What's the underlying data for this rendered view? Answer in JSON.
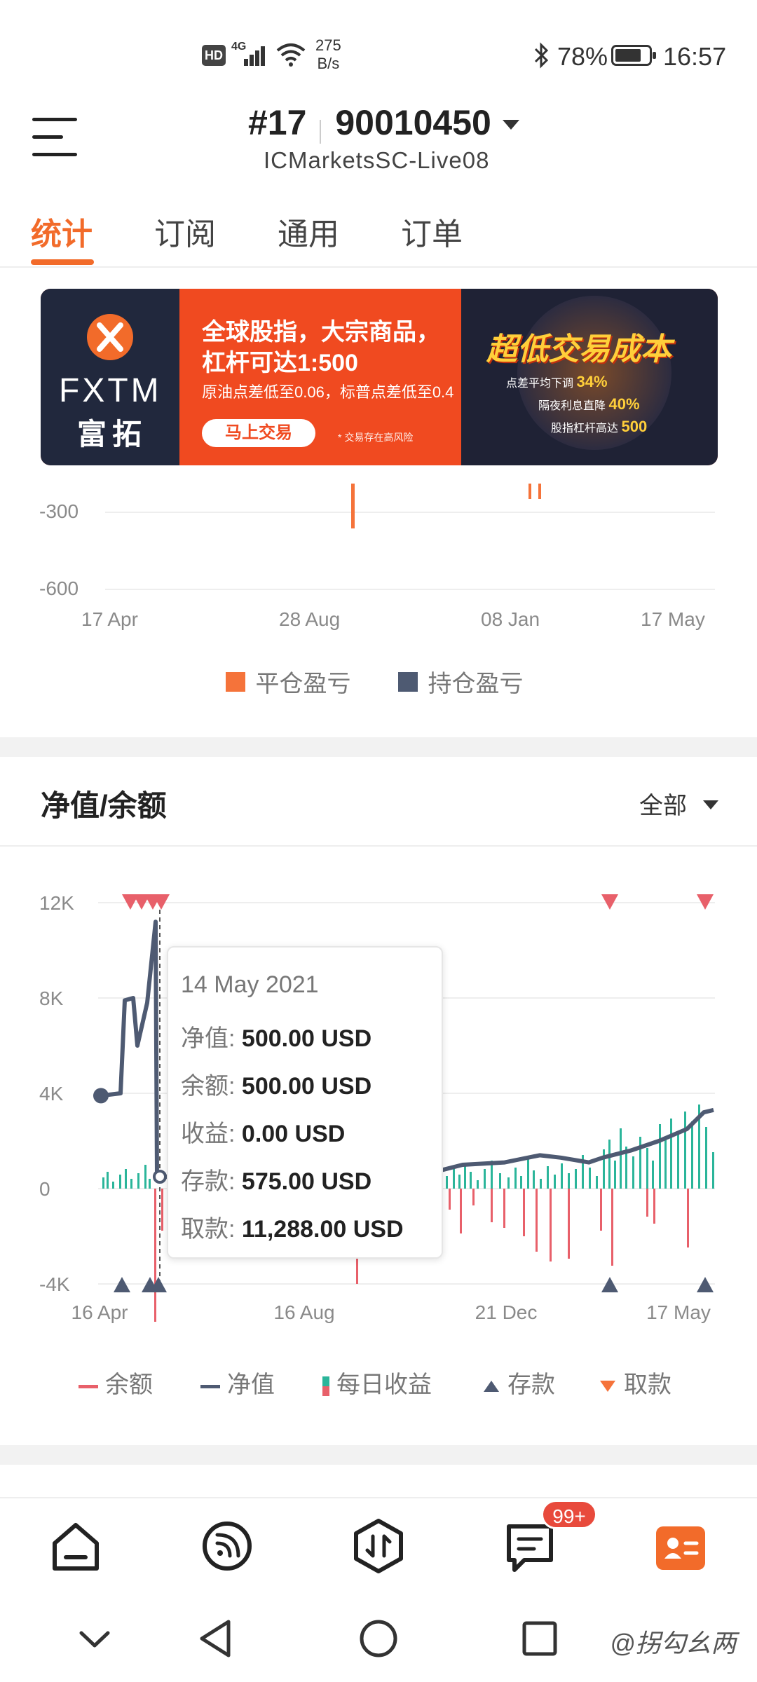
{
  "status_bar": {
    "hd": "HD",
    "network": "4G",
    "speed_value": "275",
    "speed_unit": "B/s",
    "battery": "78%",
    "time": "16:57"
  },
  "header": {
    "account_prefix": "#17",
    "account_number": "90010450",
    "server": "ICMarketsSC-Live08"
  },
  "tabs": [
    {
      "label": "统计",
      "active": true
    },
    {
      "label": "订阅",
      "active": false
    },
    {
      "label": "通用",
      "active": false
    },
    {
      "label": "订单",
      "active": false
    }
  ],
  "banner": {
    "brand": "FXTM",
    "brand_cn": "富拓",
    "headline1": "全球股指，大宗商品，",
    "headline2": "杠杆可达1:500",
    "subline": "原油点差低至0.06，标普点差低至0.4",
    "cta": "马上交易",
    "risk": "* 交易存在高风险",
    "promo_title": "超低交易成本",
    "promo1_label": "点差平均下调",
    "promo1_value": "34%",
    "promo2_label": "隔夜利息直降",
    "promo2_value": "40%",
    "promo3_label": "股指杠杆高达",
    "promo3_value": "500"
  },
  "pnl_chart": {
    "y_ticks": [
      "-300",
      "-600"
    ],
    "x_ticks": [
      "17 Apr",
      "28 Aug",
      "08 Jan",
      "17 May"
    ],
    "legend": [
      {
        "label": "平仓盈亏",
        "color": "#f5733a"
      },
      {
        "label": "持仓盈亏",
        "color": "#4e5a72"
      }
    ]
  },
  "equity_section": {
    "title": "净值/余额",
    "range": "全部"
  },
  "chart_data": {
    "type": "line",
    "y_ticks": [
      "12K",
      "8K",
      "4K",
      "0",
      "-4K"
    ],
    "x_ticks": [
      "16 Apr",
      "16 Aug",
      "21 Dec",
      "17 May"
    ],
    "ylim": [
      -4000,
      12000
    ],
    "series": [
      {
        "name": "余额",
        "color": "#e8606a"
      },
      {
        "name": "净值",
        "color": "#4e5a72",
        "values": [
          3900,
          4000,
          7900,
          8000,
          6000,
          7800,
          11200,
          500,
          500,
          700,
          1000,
          1100,
          1400,
          1300,
          1100,
          1300,
          1600,
          2000,
          2500,
          3200,
          3300
        ]
      },
      {
        "name": "每日收益",
        "color": "#2bb59a"
      },
      {
        "name": "存款",
        "color": "#4e5a72"
      },
      {
        "name": "取款",
        "color": "#f5733a"
      }
    ],
    "tooltip": {
      "date": "14 May 2021",
      "rows": [
        {
          "label": "净值:",
          "value": "500.00 USD"
        },
        {
          "label": "余额:",
          "value": "500.00 USD"
        },
        {
          "label": "收益:",
          "value": "0.00 USD"
        },
        {
          "label": "存款:",
          "value": "575.00 USD"
        },
        {
          "label": "取款:",
          "value": "11,288.00 USD"
        }
      ]
    }
  },
  "bottom_nav": {
    "badge": "99+"
  },
  "watermark": "@拐勾幺两"
}
